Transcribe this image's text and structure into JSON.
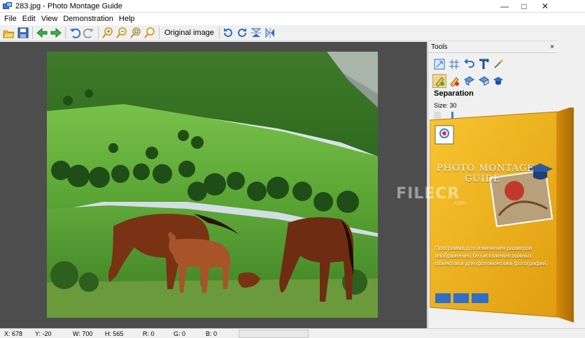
{
  "window": {
    "title": "283.jpg - Photo Montage Guide"
  },
  "menu": [
    "File",
    "Edit",
    "View",
    "Demonstration",
    "Help"
  ],
  "toolbar": {
    "original_image_label": "Original image"
  },
  "tools_panel": {
    "title": "Tools",
    "close": "×",
    "section": "Separation",
    "size_label": "Size: 30"
  },
  "box": {
    "brand_line1": "PHOTO MONTAGE",
    "brand_line2": "GUIDE",
    "description": "Программа для изменения размеров изображения, без искажения важных объектов и для фотомонтажа фотографий."
  },
  "watermark": {
    "text": "FILECR",
    "sub": ".com"
  },
  "status": {
    "x": "X: 678",
    "y": "Y: -20",
    "w": "W: 700",
    "h": "H: 565",
    "r": "R: 0",
    "g": "G: 0",
    "b": "B: 0"
  },
  "colors": {
    "accent": "#3b79d6",
    "box_yellow": "#f2b318",
    "canvas_bg": "#4d4d4d"
  }
}
